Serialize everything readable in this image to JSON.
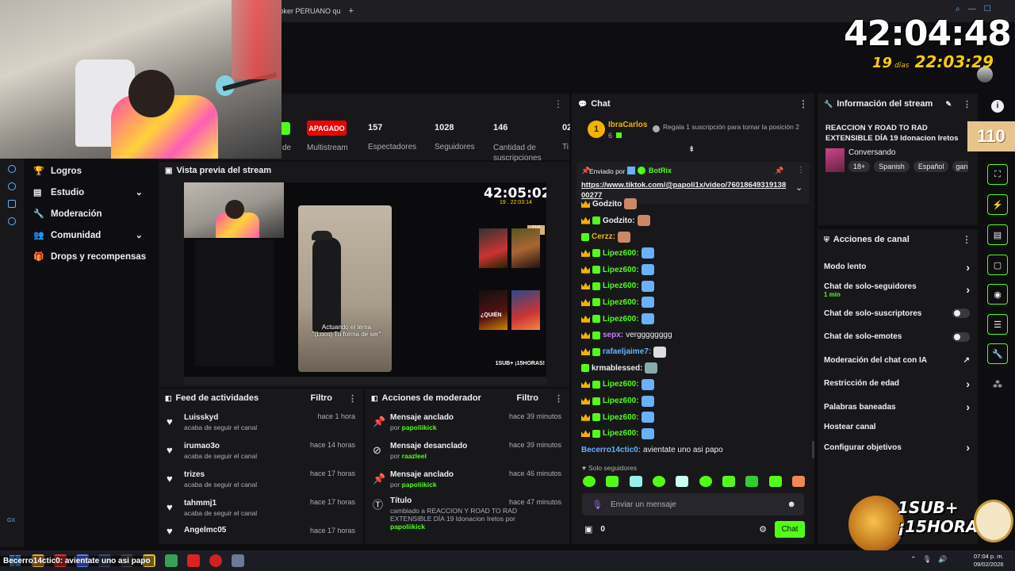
{
  "browser": {
    "tab_title": "toker PERUANO qu",
    "new_tab": "+"
  },
  "overlay": {
    "big_timer": "42:04:48",
    "days_num": "19",
    "days_label": "días",
    "sub_timer": "22:03:29",
    "promo_line1": "1SUB+",
    "promo_line2": "¡15HORAS!",
    "badge_110": "110"
  },
  "stats": {
    "status_pill": "APAGADO",
    "multistream_label": "Multistream",
    "de_fragment": "de",
    "items": [
      {
        "value": "157",
        "label": "Espectadores"
      },
      {
        "value": "1028",
        "label": "Seguidores"
      },
      {
        "value": "146",
        "label": "Cantidad de suscripciones"
      },
      {
        "value": "02",
        "label": "Ti"
      }
    ]
  },
  "sidebar": {
    "items": [
      {
        "icon": "trophy-icon",
        "label": "Logros",
        "chevron": false
      },
      {
        "icon": "layout-icon",
        "label": "Estudio",
        "chevron": true
      },
      {
        "icon": "wrench-icon",
        "label": "Moderación",
        "chevron": false
      },
      {
        "icon": "people-icon",
        "label": "Comunidad",
        "chevron": true
      },
      {
        "icon": "gift-icon",
        "label": "Drops y recompensas",
        "chevron": false
      }
    ],
    "bottom_label": "GX"
  },
  "preview": {
    "title": "Vista previa del stream",
    "mini_timer": "42:05:02",
    "mini_sub": "19 . 22:03:14",
    "caption_line1": "Actuando el tema",
    "caption_line2": "\"(Loco) Tu forma de ser\"",
    "mini_badge": "110",
    "mini_promo": "1SUB+ ¡15HORAS!",
    "mini_quien": "¿QUIÉN"
  },
  "feed": {
    "title": "Feed de actividades",
    "filter": "Filtro",
    "items": [
      {
        "name": "Luisskyd",
        "action": "acaba de seguir el canal",
        "time": "hace 1 hora"
      },
      {
        "name": "irumao3o",
        "action": "acaba de seguir el canal",
        "time": "hace 14 horas"
      },
      {
        "name": "trizes",
        "action": "acaba de seguir el canal",
        "time": "hace 17 horas"
      },
      {
        "name": "tahmmj1",
        "action": "acaba de seguir el canal",
        "time": "hace 17 horas"
      },
      {
        "name": "Angelmc05",
        "action": "",
        "time": "hace 17 horas"
      }
    ]
  },
  "modactions": {
    "title": "Acciones de moderador",
    "filter": "Filtro",
    "items": [
      {
        "icon": "pin-icon",
        "title": "Mensaje anclado",
        "by_label": "por",
        "by": "papoliikick",
        "time": "hace 39 minutos"
      },
      {
        "icon": "unpin-icon",
        "title": "Mensaje desanclado",
        "by_label": "por",
        "by": "raazleel",
        "time": "hace 39 minutos"
      },
      {
        "icon": "pin-icon",
        "title": "Mensaje anclado",
        "by_label": "por",
        "by": "papoliikick",
        "time": "hace 46 minutos"
      },
      {
        "icon": "title-icon",
        "title": "Título",
        "detail": "cambiado a REACCION Y ROAD TO RAD EXTENSIBLE DÍA 19 Idonacion Iretos",
        "by_label": "por",
        "by": "papoliikick",
        "time": "hace 47 minutos"
      }
    ]
  },
  "chat": {
    "title": "Chat",
    "gift_user": "IbraCarlos",
    "gift_count": "6",
    "gift_text": "Regala 1 suscripción para tomar la posición 2",
    "pinned_label": "Enviado por",
    "pinned_user": "BotRix",
    "pinned_link": "https://www.tiktok.com/@papoli1x/video/7601864931913800277",
    "messages": [
      {
        "user": "Godzito",
        "color": "#efeff1",
        "text": "",
        "badges": "c"
      },
      {
        "user": "Godzito:",
        "color": "#efeff1",
        "text": "",
        "badges": "cg"
      },
      {
        "user": "Cerzz:",
        "color": "#f0b400",
        "text": "",
        "badges": "g"
      },
      {
        "user": "Lipez600:",
        "color": "#53fc18",
        "text": "",
        "badges": "cg"
      },
      {
        "user": "Lipez600:",
        "color": "#53fc18",
        "text": "",
        "badges": "cg"
      },
      {
        "user": "Lipez600:",
        "color": "#53fc18",
        "text": "",
        "badges": "cg"
      },
      {
        "user": "Lipez600:",
        "color": "#53fc18",
        "text": "",
        "badges": "cg"
      },
      {
        "user": "Lipez600:",
        "color": "#53fc18",
        "text": "",
        "badges": "cg"
      },
      {
        "user": "sepx:",
        "color": "#c57cff",
        "text": "vergggggggg",
        "badges": "cg"
      },
      {
        "user": "rafaeljaime7:",
        "color": "#6ab0ff",
        "text": "",
        "badges": "cg"
      },
      {
        "user": "krmablessed:",
        "color": "#efeff1",
        "text": "",
        "badges": "g"
      },
      {
        "user": "Lipez600:",
        "color": "#53fc18",
        "text": "",
        "badges": "cg"
      },
      {
        "user": "Lipez600:",
        "color": "#53fc18",
        "text": "",
        "badges": "cg"
      },
      {
        "user": "Lipez600:",
        "color": "#53fc18",
        "text": "",
        "badges": "cg"
      },
      {
        "user": "Lipez600:",
        "color": "#53fc18",
        "text": "",
        "badges": "cg"
      },
      {
        "user": "Becerro14ctic0:",
        "color": "#6ab0ff",
        "text": "avientate uno asi papo",
        "badges": ""
      }
    ],
    "followers_only": "Solo seguidores",
    "input_placeholder": "Enviar un mensaje",
    "points": "0",
    "send": "Chat"
  },
  "streaminfo": {
    "title": "Información del stream",
    "stream_title": "REACCION Y ROAD TO RAD EXTENSIBLE DÍA 19 Idonacion Iretos",
    "category": "Conversando",
    "tags": [
      "18+",
      "Spanish",
      "Español",
      "gan"
    ]
  },
  "channelactions": {
    "title": "Acciones de canal",
    "rows": [
      {
        "label": "Modo lento",
        "kind": "arrow"
      },
      {
        "label": "Chat de solo-seguidores",
        "sub": "1 min",
        "kind": "arrow"
      },
      {
        "label": "Chat de solo-suscriptores",
        "kind": "toggle"
      },
      {
        "label": "Chat de solo-emotes",
        "kind": "toggle"
      },
      {
        "label": "Moderación del chat con IA",
        "kind": "external"
      },
      {
        "label": "Restricción de edad",
        "kind": "arrow"
      },
      {
        "label": "Palabras baneadas",
        "kind": "arrow"
      },
      {
        "label": "Hostear canal",
        "kind": "none"
      },
      {
        "label": "Configurar objetivos",
        "kind": "arrow"
      }
    ]
  },
  "taskbar": {
    "ticker": "Becerro14ctic0: avientate uno asi papo",
    "time": "07:04 p. m.",
    "date": "09/02/2026"
  },
  "colors": {
    "accent": "#53fc18",
    "bg": "#0e0e10",
    "panel": "#18181b",
    "live_red": "#eb0400",
    "crown": "#f0b400"
  }
}
